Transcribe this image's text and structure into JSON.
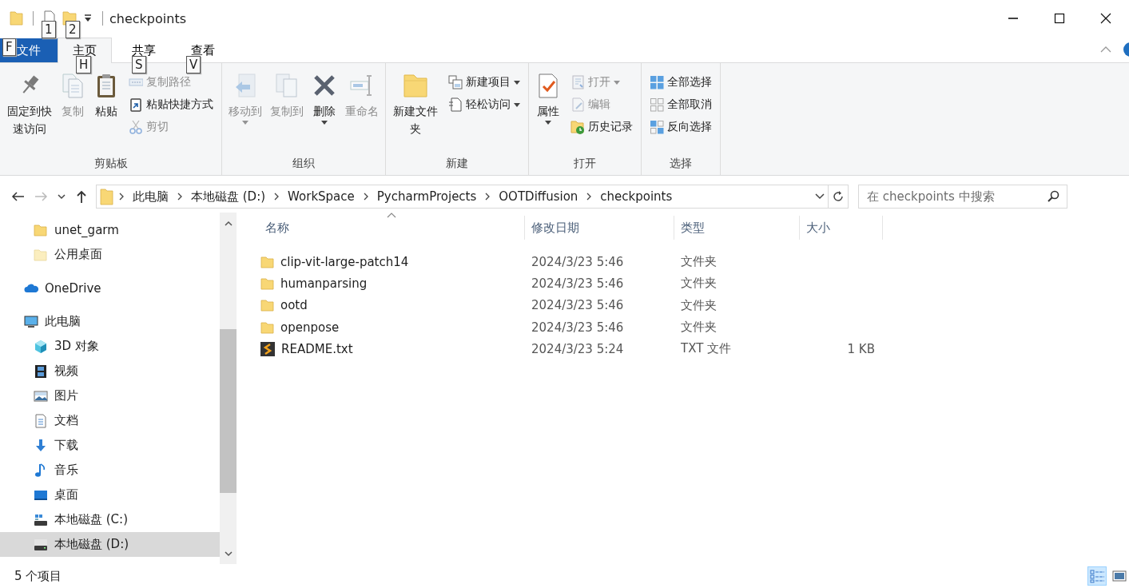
{
  "window": {
    "title": "checkpoints"
  },
  "key_tips": [
    "1",
    "2",
    "F",
    "H",
    "S",
    "V"
  ],
  "tabs": [
    {
      "label": "文件",
      "kind": "file",
      "selected": false
    },
    {
      "label": "主页",
      "kind": "tab",
      "selected": true
    },
    {
      "label": "共享",
      "kind": "tab",
      "selected": false
    },
    {
      "label": "查看",
      "kind": "tab",
      "selected": false
    }
  ],
  "ribbon": {
    "groups": [
      {
        "label": "剪贴板",
        "items": [
          {
            "kind": "large",
            "label": "固定到快速访问",
            "disabled": false,
            "dropdown": false
          },
          {
            "kind": "large",
            "label": "复制",
            "disabled": true,
            "dropdown": false
          },
          {
            "kind": "large",
            "label": "粘贴",
            "disabled": false,
            "dropdown": false
          },
          {
            "kind": "stack",
            "items": [
              {
                "label": "复制路径",
                "disabled": true,
                "dropdown": false
              },
              {
                "label": "粘贴快捷方式",
                "disabled": false,
                "dropdown": false
              },
              {
                "label": "剪切",
                "disabled": true,
                "dropdown": false
              }
            ]
          }
        ]
      },
      {
        "label": "组织",
        "items": [
          {
            "kind": "large",
            "label": "移动到",
            "disabled": true,
            "dropdown": true
          },
          {
            "kind": "large",
            "label": "复制到",
            "disabled": true,
            "dropdown": false
          },
          {
            "kind": "large",
            "label": "删除",
            "disabled": false,
            "dropdown": true
          },
          {
            "kind": "large",
            "label": "重命名",
            "disabled": true,
            "dropdown": false
          }
        ]
      },
      {
        "label": "新建",
        "items": [
          {
            "kind": "large",
            "label": "新建文件夹",
            "disabled": false,
            "dropdown": false
          },
          {
            "kind": "stack",
            "items": [
              {
                "label": "新建项目",
                "disabled": false,
                "dropdown": true
              },
              {
                "label": "轻松访问",
                "disabled": false,
                "dropdown": true
              }
            ]
          }
        ]
      },
      {
        "label": "打开",
        "items": [
          {
            "kind": "large",
            "label": "属性",
            "disabled": false,
            "dropdown": true
          },
          {
            "kind": "stack",
            "items": [
              {
                "label": "打开",
                "disabled": true,
                "dropdown": true
              },
              {
                "label": "编辑",
                "disabled": true,
                "dropdown": false
              },
              {
                "label": "历史记录",
                "disabled": false,
                "dropdown": false
              }
            ]
          }
        ]
      },
      {
        "label": "选择",
        "items": [
          {
            "kind": "stack",
            "items": [
              {
                "label": "全部选择",
                "disabled": false,
                "dropdown": false
              },
              {
                "label": "全部取消",
                "disabled": false,
                "dropdown": false
              },
              {
                "label": "反向选择",
                "disabled": false,
                "dropdown": false
              }
            ]
          }
        ]
      }
    ]
  },
  "address": {
    "crumbs": [
      "此电脑",
      "本地磁盘 (D:)",
      "WorkSpace",
      "PycharmProjects",
      "OOTDiffusion",
      "checkpoints"
    ]
  },
  "search": {
    "placeholder": "在 checkpoints 中搜索"
  },
  "nav": {
    "items": [
      {
        "children": [
          {
            "label": "unet_garm",
            "kind": "folder",
            "selected": false
          },
          {
            "label": "公用桌面",
            "kind": "publicfolder",
            "selected": false
          }
        ]
      },
      {
        "label": "OneDrive",
        "kind": "cloud",
        "selected": false
      },
      {
        "label": "此电脑",
        "kind": "computer",
        "selected": false,
        "children": [
          {
            "label": "3D 对象",
            "kind": "cube",
            "selected": false
          },
          {
            "label": "视频",
            "kind": "film",
            "selected": false
          },
          {
            "label": "图片",
            "kind": "image",
            "selected": false
          },
          {
            "label": "文档",
            "kind": "document",
            "selected": false
          },
          {
            "label": "下载",
            "kind": "download",
            "selected": false
          },
          {
            "label": "音乐",
            "kind": "music",
            "selected": false
          },
          {
            "label": "桌面",
            "kind": "desktop",
            "selected": false
          },
          {
            "label": "本地磁盘 (C:)",
            "kind": "systemdrive",
            "selected": false
          },
          {
            "label": "本地磁盘 (D:)",
            "kind": "drive",
            "selected": true
          }
        ]
      }
    ]
  },
  "file_list": {
    "columns": [
      {
        "label": "名称",
        "sorted": true
      },
      {
        "label": "修改日期",
        "sorted": false
      },
      {
        "label": "类型",
        "sorted": false
      },
      {
        "label": "大小",
        "sorted": false
      }
    ],
    "rows": [
      {
        "kind": "folder",
        "name": "clip-vit-large-patch14",
        "date": "2024/3/23 5:46",
        "type": "文件夹"
      },
      {
        "kind": "folder",
        "name": "humanparsing",
        "date": "2024/3/23 5:46",
        "type": "文件夹"
      },
      {
        "kind": "folder",
        "name": "ootd",
        "date": "2024/3/23 5:46",
        "type": "文件夹"
      },
      {
        "kind": "folder",
        "name": "openpose",
        "date": "2024/3/23 5:46",
        "type": "文件夹"
      },
      {
        "kind": "text",
        "name": "README.txt",
        "date": "2024/3/23 5:24",
        "type": "TXT 文件",
        "size": "1 KB"
      }
    ]
  },
  "status_bar": {
    "text": "5 个项目",
    "views": [
      {
        "selected": true
      },
      {
        "selected": false
      }
    ]
  }
}
